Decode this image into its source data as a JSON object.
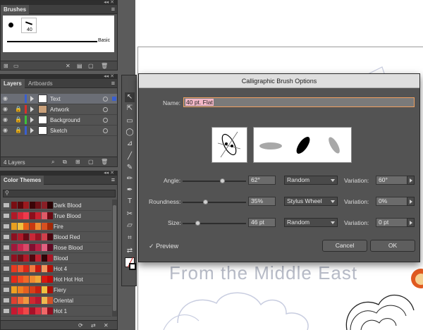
{
  "brushes_panel": {
    "tab": "Brushes",
    "brush_size": "40",
    "basic_label": "Basic"
  },
  "layers_panel": {
    "tabs": [
      "Layers",
      "Artboards"
    ],
    "layers": [
      {
        "name": "Text",
        "color": "#3a5fcf",
        "selected": true
      },
      {
        "name": "Artwork",
        "color": "#d8302a",
        "selected": false
      },
      {
        "name": "Background",
        "color": "#3ec23a",
        "selected": false
      },
      {
        "name": "Sketch",
        "color": "#3a5fcf",
        "selected": false
      }
    ],
    "count_label": "4 Layers"
  },
  "color_themes_panel": {
    "tab": "Color Themes",
    "themes": [
      {
        "name": "Dark Blood",
        "swatches": [
          "#7a0d12",
          "#5a080c",
          "#9c1a1e",
          "#3a0508",
          "#6b1016",
          "#8a1f26",
          "#2a0305"
        ]
      },
      {
        "name": "True Blood",
        "swatches": [
          "#b01a28",
          "#d8283a",
          "#f03a4c",
          "#8c0f1c",
          "#c8222f",
          "#e05a66",
          "#6a0a14"
        ]
      },
      {
        "name": "Fire",
        "swatches": [
          "#e8a020",
          "#f0c040",
          "#e86018",
          "#c83810",
          "#f08a30",
          "#d85020",
          "#a02808"
        ]
      },
      {
        "name": "Blood Red",
        "swatches": [
          "#8c1020",
          "#b01a2a",
          "#6a0a16",
          "#c82838",
          "#9a1424",
          "#d0404c",
          "#4a0610"
        ]
      },
      {
        "name": "Rose Blood",
        "swatches": [
          "#a0183a",
          "#c82850",
          "#d84868",
          "#801030",
          "#b82044",
          "#e06080",
          "#600a24"
        ]
      },
      {
        "name": "Blood",
        "swatches": [
          "#901020",
          "#701018",
          "#b01a28",
          "#500810",
          "#c02030",
          "#300408",
          "#a81828"
        ]
      },
      {
        "name": "Hot 4",
        "swatches": [
          "#e83a20",
          "#f05a30",
          "#d82818",
          "#f07a40",
          "#c81810",
          "#f09860",
          "#b01008"
        ]
      },
      {
        "name": "Hot Hot Hot",
        "swatches": [
          "#e82818",
          "#f04a20",
          "#f06a28",
          "#f08a30",
          "#f0a838",
          "#d81810",
          "#c00808"
        ]
      },
      {
        "name": "Fiery",
        "swatches": [
          "#f0a020",
          "#f08020",
          "#e86020",
          "#d84018",
          "#c82010",
          "#f0c040",
          "#a81008"
        ]
      },
      {
        "name": "Oriental",
        "swatches": [
          "#e04030",
          "#f06a38",
          "#f09840",
          "#d02830",
          "#b81830",
          "#f0b850",
          "#d05028"
        ]
      },
      {
        "name": "Hot 1",
        "swatches": [
          "#c81830",
          "#e02838",
          "#f04848",
          "#a81028",
          "#d83040",
          "#f06868",
          "#901020"
        ]
      }
    ]
  },
  "dialog": {
    "title": "Calligraphic Brush Options",
    "name_label": "Name:",
    "name_value": "40 pt. Flat",
    "angle": {
      "label": "Angle:",
      "value": "62°",
      "mode": "Random",
      "variation_label": "Variation:",
      "variation": "60°",
      "slider_fraction": 0.62
    },
    "roundness": {
      "label": "Roundness:",
      "value": "35%",
      "mode": "Stylus Wheel",
      "variation_label": "Variation:",
      "variation": "0%",
      "slider_fraction": 0.35
    },
    "size": {
      "label": "Size:",
      "value": "46 pt",
      "mode": "Random",
      "variation_label": "Variation:",
      "variation": "0 pt",
      "slider_fraction": 0.23
    },
    "preview_label": "Preview",
    "preview_checked": true,
    "cancel_label": "Cancel",
    "ok_label": "OK"
  },
  "canvas": {
    "sketch_text": "From the Middle East"
  }
}
